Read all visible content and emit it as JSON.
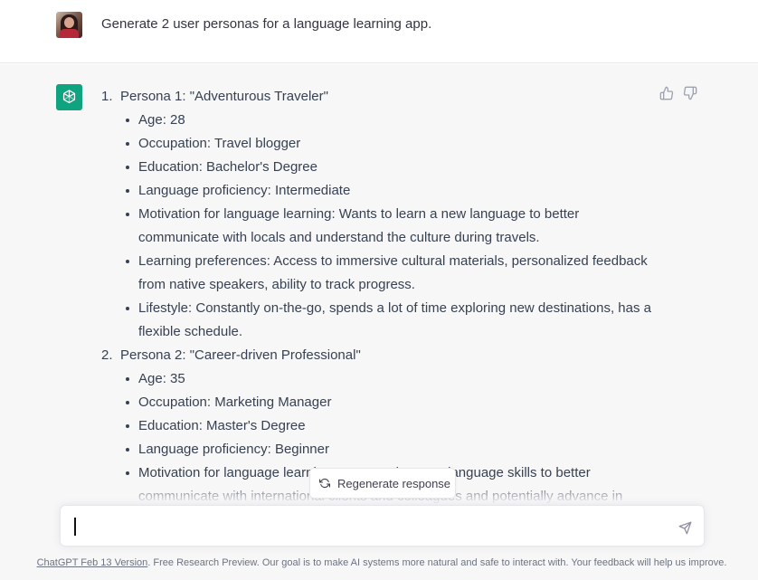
{
  "user_message": {
    "text": "Generate 2 user personas for a language learning app.",
    "avatar_icon": "user-photo-avatar"
  },
  "assistant": {
    "avatar_icon": "openai-logo-icon",
    "avatar_color": "#10a37f",
    "personas": [
      {
        "number": "1.",
        "title": "Persona 1: \"Adventurous Traveler\"",
        "attributes": [
          "Age: 28",
          "Occupation: Travel blogger",
          "Education: Bachelor's Degree",
          "Language proficiency: Intermediate",
          "Motivation for language learning: Wants to learn a new language to better communicate with locals and understand the culture during travels.",
          "Learning preferences: Access to immersive cultural materials, personalized feedback from native speakers, ability to track progress.",
          "Lifestyle: Constantly on-the-go, spends a lot of time exploring new destinations, has a flexible schedule."
        ]
      },
      {
        "number": "2.",
        "title": "Persona 2: \"Career-driven Professional\"",
        "attributes": [
          "Age: 35",
          "Occupation: Marketing Manager",
          "Education: Master's Degree",
          "Language proficiency: Beginner",
          "Motivation for language learning: Wants to improve language skills to better communicate with international clients and colleagues and potentially advance in"
        ]
      }
    ],
    "feedback_icons": [
      "thumbs-up-icon",
      "thumbs-down-icon"
    ]
  },
  "regenerate_button": {
    "label": "Regenerate response",
    "icon": "refresh-icon"
  },
  "composer": {
    "value": "",
    "placeholder": "",
    "send_icon": "send-icon"
  },
  "footer": {
    "link_text": "ChatGPT Feb 13 Version",
    "text": ". Free Research Preview. Our goal is to make AI systems more natural and safe to interact with. Your feedback will help us improve."
  },
  "colors": {
    "brand_green": "#10a37f",
    "assistant_bg": "#f7f7f8",
    "text": "#374151"
  }
}
